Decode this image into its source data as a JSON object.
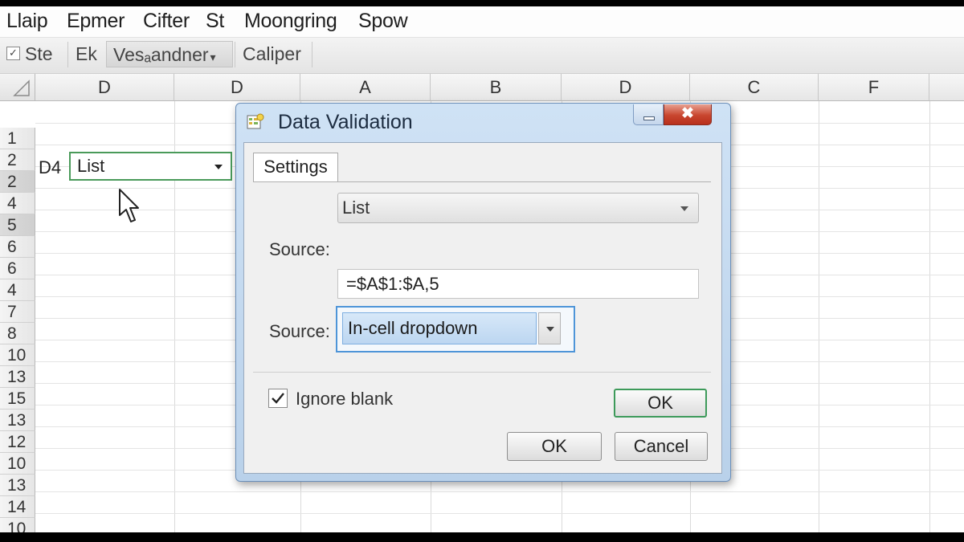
{
  "menu": {
    "items": [
      "Llaip",
      "Epmer",
      "Cifter",
      "St",
      "Moongring",
      "Spow"
    ]
  },
  "toolbar": {
    "item1": "Ste",
    "item2": "Ek",
    "item3": "Vesₐandner",
    "item3_arrow": "▾",
    "item4": "Caliper"
  },
  "sheet": {
    "columns": [
      "D",
      "D",
      "A",
      "B",
      "D",
      "C",
      "F"
    ],
    "rows": [
      "1",
      "2",
      "2",
      "4",
      "5",
      "6",
      "6",
      "4",
      "7",
      "8",
      "10",
      "13",
      "15",
      "13",
      "12",
      "10",
      "13",
      "14",
      "10"
    ],
    "cell_ref": "D4",
    "cell_value": "List"
  },
  "dialog": {
    "title": "Data Validation",
    "close_glyph": "✖",
    "tab": "Settings",
    "allow_value": "List",
    "source_label": "Source:",
    "source_value": "=$A$1:$A,5",
    "source_label2": "Source:",
    "incell_value": "In-cell dropdown",
    "ignore_blank_label": "Ignore blank",
    "ignore_blank_checked": true,
    "ok_default_label": "OK",
    "ok_label": "OK",
    "cancel_label": "Cancel"
  },
  "colors": {
    "accent_green": "#3d9a5a",
    "focus_blue": "#4e95d8",
    "close_red": "#c8452e"
  }
}
